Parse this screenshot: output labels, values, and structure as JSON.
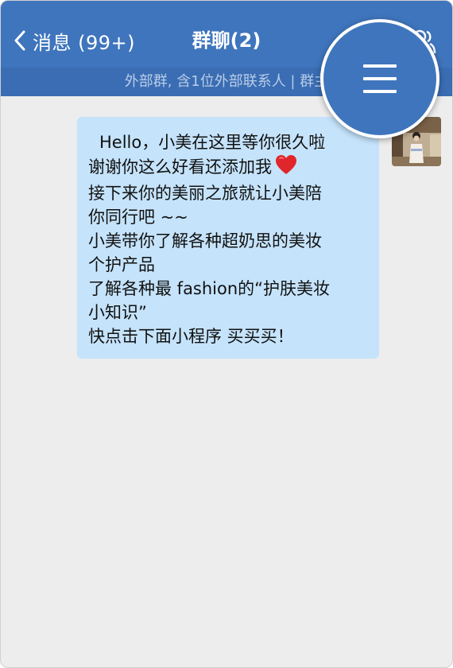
{
  "navbar": {
    "back_label": "消息 (99+)",
    "title": "群聊(2)",
    "subtitle": "外部群, 含1位外部联系人 | 群主"
  },
  "icons": {
    "back": "chevron-left-icon",
    "group_settings": "group-members-icon",
    "menu": "hamburger-menu-icon",
    "heart": "red-heart-icon"
  },
  "colors": {
    "navbar": "#3f75bd",
    "subbar": "#3a6db3",
    "chat_background": "#ededed",
    "bubble": "#c5e3fb",
    "heart": "#e0262a"
  },
  "message": {
    "lines": [
      "Hello，小美在这里等你很久啦",
      "谢谢你这么好看还添加我",
      "接下来你的美丽之旅就让小美陪",
      "你同行吧 ~~",
      "小美带你了解各种超奶思的美妆",
      "个护产品",
      "了解各种最 fashion的“护肤美妆",
      "小知识”",
      "快点击下面小程序 买买买！"
    ]
  }
}
